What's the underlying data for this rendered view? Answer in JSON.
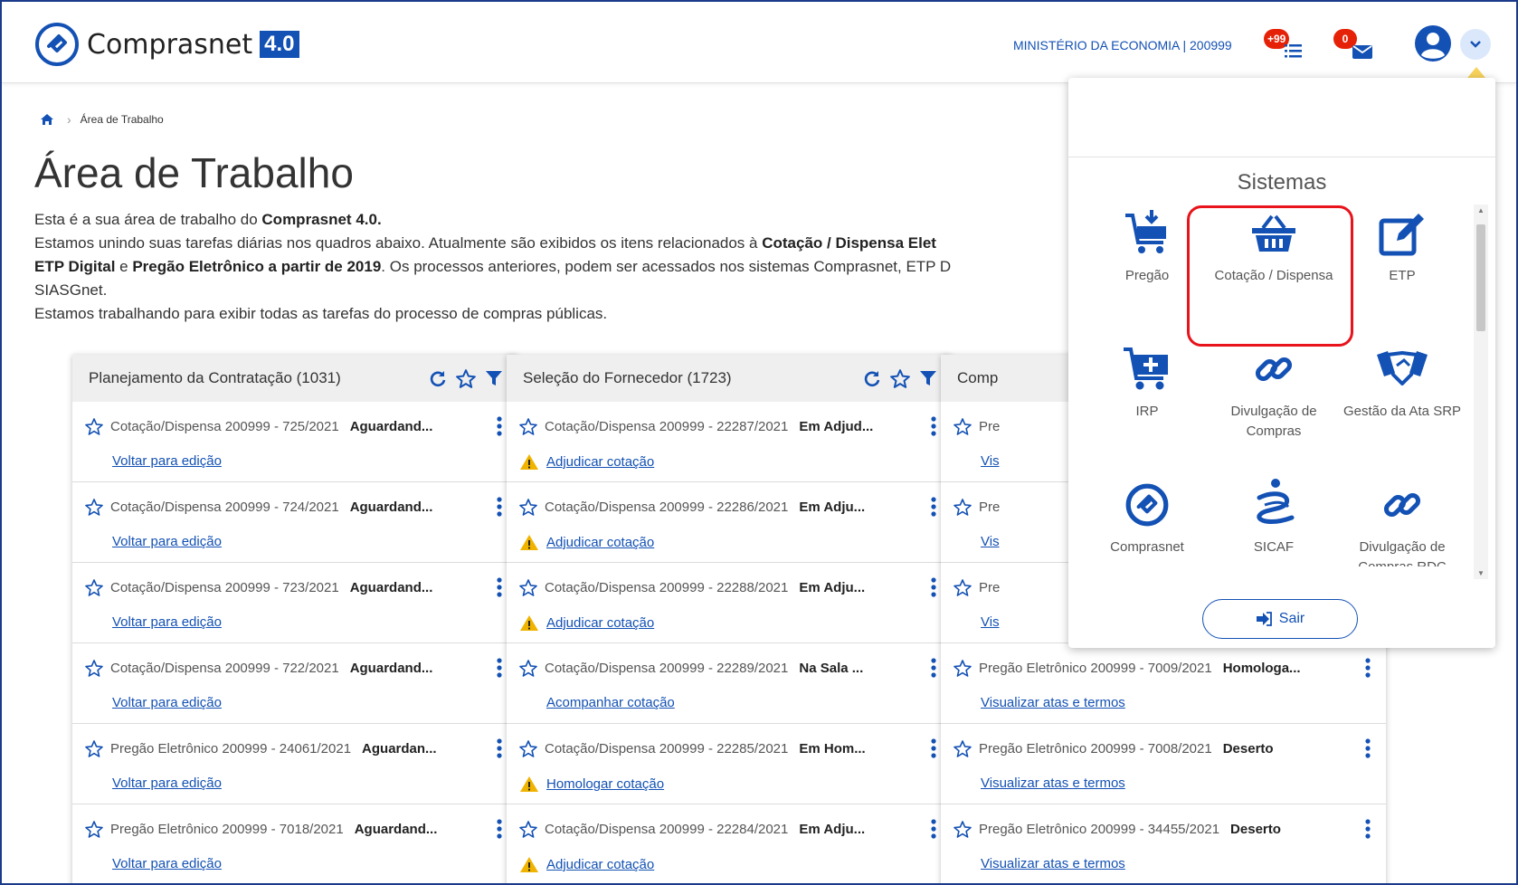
{
  "header": {
    "logo_text": "Comprasnet",
    "logo_version": "4.0",
    "ministry": "MINISTÉRIO DA ECONOMIA | 200999",
    "notifications_badge": "+99",
    "messages_badge": "0"
  },
  "breadcrumb": {
    "current": "Área de Trabalho"
  },
  "page": {
    "title": "Área de Trabalho",
    "intro1_a": "Esta é a sua área de trabalho do ",
    "intro1_b": "Comprasnet 4.0.",
    "intro2_a": "Estamos unindo suas tarefas diárias nos quadros abaixo. Atualmente são exibidos os itens relacionados à ",
    "intro2_b": "Cotação / Dispensa Elet",
    "intro3_a": "ETP Digital",
    "intro3_b": " e ",
    "intro3_c": "Pregão Eletrônico a partir de 2019",
    "intro3_d": ". Os processos anteriores, podem ser acessados nos sistemas Comprasnet, ETP D",
    "intro4": "SIASGnet.",
    "intro5": "Estamos trabalhando para exibir todas as tarefas do processo de compras públicas."
  },
  "panels": [
    {
      "title": "Planejamento da Contratação (1031)",
      "rows": [
        {
          "name": "Cotação/Dispensa 200999 - 725/2021",
          "status": "Aguardand...",
          "link": "Voltar para edição",
          "warn": false
        },
        {
          "name": "Cotação/Dispensa 200999 - 724/2021",
          "status": "Aguardand...",
          "link": "Voltar para edição",
          "warn": false
        },
        {
          "name": "Cotação/Dispensa 200999 - 723/2021",
          "status": "Aguardand...",
          "link": "Voltar para edição",
          "warn": false
        },
        {
          "name": "Cotação/Dispensa 200999 - 722/2021",
          "status": "Aguardand...",
          "link": "Voltar para edição",
          "warn": false
        },
        {
          "name": "Pregão Eletrônico 200999 - 24061/2021",
          "status": "Aguardan...",
          "link": "Voltar para edição",
          "warn": false
        },
        {
          "name": "Pregão Eletrônico 200999 - 7018/2021",
          "status": "Aguardand...",
          "link": "Voltar para edição",
          "warn": false
        }
      ]
    },
    {
      "title": "Seleção do Fornecedor (1723)",
      "rows": [
        {
          "name": "Cotação/Dispensa 200999 - 22287/2021",
          "status": "Em Adjud...",
          "link": "Adjudicar cotação",
          "warn": true
        },
        {
          "name": "Cotação/Dispensa 200999 - 22286/2021",
          "status": "Em Adju...",
          "link": "Adjudicar cotação",
          "warn": true
        },
        {
          "name": "Cotação/Dispensa 200999 - 22288/2021",
          "status": "Em Adju...",
          "link": "Adjudicar cotação",
          "warn": true
        },
        {
          "name": "Cotação/Dispensa 200999 - 22289/2021",
          "status": "Na Sala ...",
          "link": "Acompanhar cotação",
          "warn": false
        },
        {
          "name": "Cotação/Dispensa 200999 - 22285/2021",
          "status": "Em Hom...",
          "link": "Homologar cotação",
          "warn": true
        },
        {
          "name": "Cotação/Dispensa 200999 - 22284/2021",
          "status": "Em Adju...",
          "link": "Adjudicar cotação",
          "warn": true
        }
      ]
    },
    {
      "title": "Comp",
      "rows": [
        {
          "name": "Pre",
          "status": "",
          "link": "Vis",
          "warn": false
        },
        {
          "name": "Pre",
          "status": "",
          "link": "Vis",
          "warn": false
        },
        {
          "name": "Pre",
          "status": "",
          "link": "Vis",
          "warn": false
        },
        {
          "name": "Pregão Eletrônico 200999 - 7009/2021",
          "status": "Homologa...",
          "link": "Visualizar atas e termos",
          "warn": false
        },
        {
          "name": "Pregão Eletrônico 200999 - 7008/2021",
          "status": "Deserto",
          "link": "Visualizar atas e termos",
          "warn": false
        },
        {
          "name": "Pregão Eletrônico 200999 - 34455/2021",
          "status": "Deserto",
          "link": "Visualizar atas e termos",
          "warn": false
        }
      ]
    }
  ],
  "dropdown": {
    "heading": "Sistemas",
    "tiles": [
      {
        "label": "Pregão",
        "icon": "cart-download-icon"
      },
      {
        "label": "Cotação / Dispensa",
        "icon": "basket-icon"
      },
      {
        "label": "ETP",
        "icon": "edit-icon"
      },
      {
        "label": "IRP",
        "icon": "cart-plus-icon"
      },
      {
        "label": "Divulgação de Compras",
        "icon": "link-icon"
      },
      {
        "label": "Gestão da Ata SRP",
        "icon": "handshake-icon"
      },
      {
        "label": "Comprasnet",
        "icon": "comprasnet-icon"
      },
      {
        "label": "SICAF",
        "icon": "sicaf-icon"
      },
      {
        "label": "Divulgação de Compras RDC",
        "icon": "link-icon"
      }
    ],
    "logout": "Sair"
  },
  "colors": {
    "primary": "#1351b4",
    "badge": "#e52207",
    "highlight": "#e8131b",
    "warning": "#f0b400"
  }
}
